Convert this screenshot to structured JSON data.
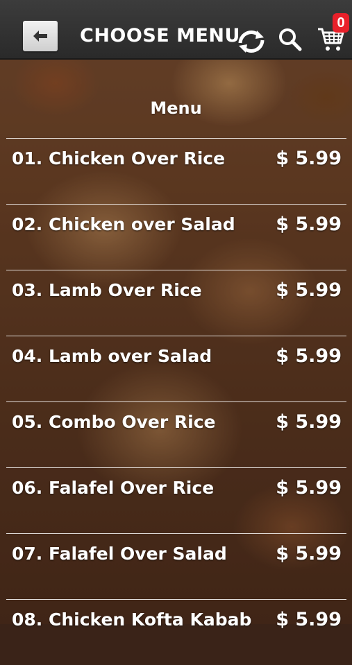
{
  "header": {
    "title": "CHOOSE MENU",
    "back_icon": "back-arrow-icon",
    "refresh_icon": "refresh-icon",
    "search_icon": "search-icon",
    "cart_icon": "cart-icon",
    "cart_count": "0",
    "badge_color": "#e8202a"
  },
  "menu": {
    "title": "Menu",
    "items": [
      {
        "name": "01. Chicken Over Rice",
        "price": "$ 5.99"
      },
      {
        "name": "02. Chicken over Salad",
        "price": "$ 5.99"
      },
      {
        "name": "03. Lamb Over Rice",
        "price": "$ 5.99"
      },
      {
        "name": "04. Lamb over Salad",
        "price": "$ 5.99"
      },
      {
        "name": "05. Combo Over Rice",
        "price": "$ 5.99"
      },
      {
        "name": "06. Falafel Over Rice",
        "price": "$ 5.99"
      },
      {
        "name": "07. Falafel Over Salad",
        "price": "$ 5.99"
      },
      {
        "name": "08. Chicken Kofta Kabab",
        "price": "$ 5.99"
      }
    ]
  }
}
